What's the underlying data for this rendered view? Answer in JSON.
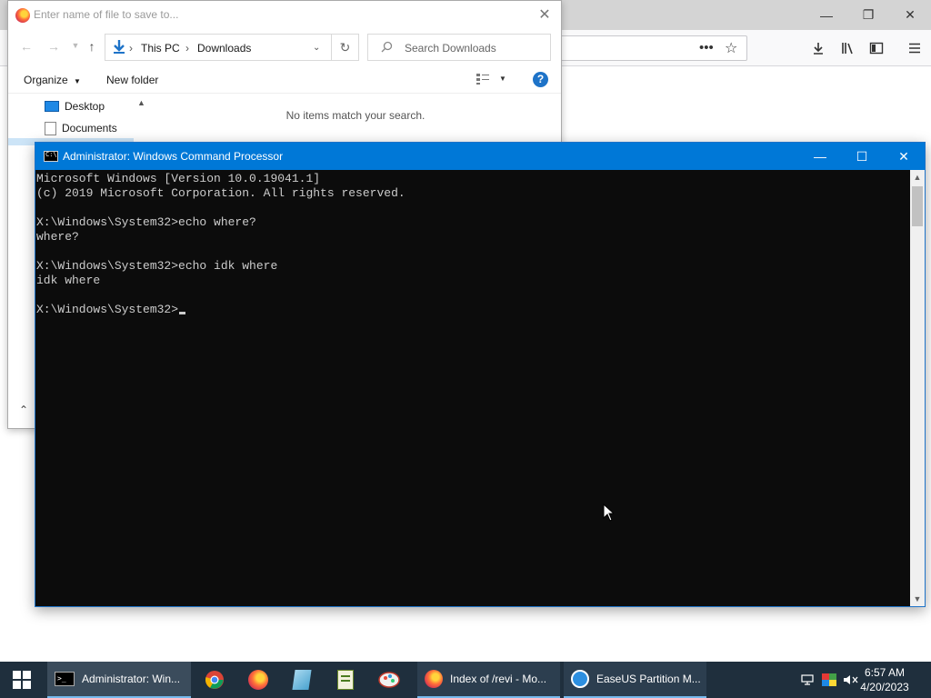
{
  "save_dialog": {
    "title_placeholder": "Enter name of file to save to...",
    "breadcrumb": [
      "This PC",
      "Downloads"
    ],
    "search_placeholder": "Search Downloads",
    "organize_label": "Organize",
    "new_folder_label": "New folder",
    "tree_items": [
      "Desktop",
      "Documents"
    ],
    "empty_message": "No items match your search."
  },
  "cmd": {
    "title": "Administrator: Windows Command Processor",
    "lines": [
      "Microsoft Windows [Version 10.0.19041.1]",
      "(c) 2019 Microsoft Corporation. All rights reserved.",
      "",
      "X:\\Windows\\System32>echo where?",
      "where?",
      "",
      "X:\\Windows\\System32>echo idk where",
      "idk where",
      "",
      "X:\\Windows\\System32>"
    ]
  },
  "taskbar": {
    "tasks": [
      {
        "label": "Administrator: Win...",
        "icon": "cmd-icon"
      },
      {
        "label": "Index of /revi - Mo...",
        "icon": "firefox-icon"
      },
      {
        "label": "EaseUS Partition M...",
        "icon": "easeus-icon"
      }
    ],
    "pinned": [
      "chrome-icon",
      "firefox-icon",
      "notepad-icon",
      "editor-icon",
      "paint-icon"
    ],
    "time": "6:57 AM",
    "date": "4/20/2023"
  },
  "colors": {
    "cmd_titlebar": "#0078d7",
    "cmd_background": "#0c0c0c",
    "taskbar": "#1f2f3d",
    "help_icon": "#1e73c8"
  }
}
